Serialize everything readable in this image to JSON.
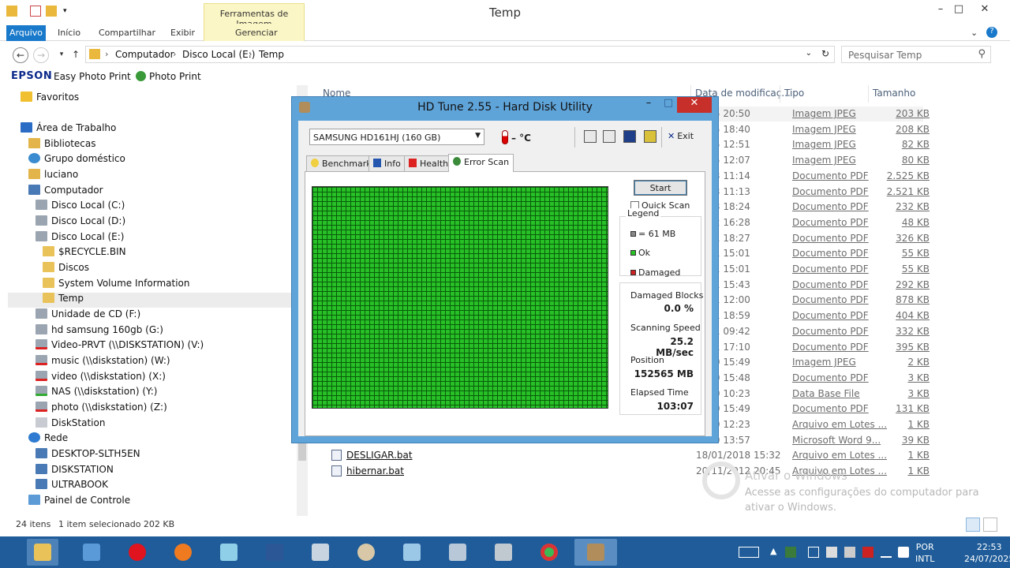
{
  "window": {
    "title": "Temp",
    "context_tab_top": "Ferramentas de Imagem",
    "context_tab_bottom": "Gerenciar"
  },
  "ribbon": {
    "tabs": [
      "Arquivo",
      "Início",
      "Compartilhar",
      "Exibir"
    ]
  },
  "address": {
    "crumbs": [
      "Computador",
      "Disco Local (E:)",
      "Temp"
    ],
    "search_placeholder": "Pesquisar Temp"
  },
  "epson": {
    "logo": "EPSON",
    "item1": "Easy Photo Print",
    "item2": "Photo Print"
  },
  "nav": {
    "favorites": "Favoritos",
    "items": [
      "Área de Trabalho",
      "Bibliotecas",
      "Grupo doméstico",
      "luciano",
      "Computador",
      "Disco Local (C:)",
      "Disco Local (D:)",
      "Disco Local (E:)",
      "$RECYCLE.BIN",
      "Discos",
      "System Volume Information",
      "Temp",
      "Unidade de CD (F:)",
      "hd samsung 160gb (G:)",
      "Video-PRVT (\\\\DISKSTATION) (V:)",
      "music (\\\\diskstation) (W:)",
      "video (\\\\diskstation) (X:)",
      "NAS (\\\\diskstation) (Y:)",
      "photo (\\\\diskstation) (Z:)",
      "DiskStation",
      "Rede",
      "DESKTOP-SLTH5EN",
      "DISKSTATION",
      "ULTRABOOK",
      "Painel de Controle"
    ]
  },
  "filelist": {
    "columns": [
      "Nome",
      "Data de modificaç...",
      "Tipo",
      "Tamanho"
    ],
    "rows": [
      {
        "name": "",
        "date": "2025 20:50",
        "type": "Imagem JPEG",
        "size": "203 KB"
      },
      {
        "name": "",
        "date": "2025 18:40",
        "type": "Imagem JPEG",
        "size": "208 KB"
      },
      {
        "name": "",
        "date": "2025 12:51",
        "type": "Imagem JPEG",
        "size": "82 KB"
      },
      {
        "name": "",
        "date": "2025 12:07",
        "type": "Imagem JPEG",
        "size": "80 KB"
      },
      {
        "name": "",
        "date": "2023 11:14",
        "type": "Documento PDF",
        "size": "2.525 KB"
      },
      {
        "name": "",
        "date": "2023 11:13",
        "type": "Documento PDF",
        "size": "2.521 KB"
      },
      {
        "name": "",
        "date": "2023 18:24",
        "type": "Documento PDF",
        "size": "232 KB"
      },
      {
        "name": "",
        "date": "2022 16:28",
        "type": "Documento PDF",
        "size": "48 KB"
      },
      {
        "name": "",
        "date": "2021 18:27",
        "type": "Documento PDF",
        "size": "326 KB"
      },
      {
        "name": "",
        "date": "2021 15:01",
        "type": "Documento PDF",
        "size": "55 KB"
      },
      {
        "name": "",
        "date": "2021 15:01",
        "type": "Documento PDF",
        "size": "55 KB"
      },
      {
        "name": "",
        "date": "2021 15:43",
        "type": "Documento PDF",
        "size": "292 KB"
      },
      {
        "name": "",
        "date": "2021 12:00",
        "type": "Documento PDF",
        "size": "878 KB"
      },
      {
        "name": "",
        "date": "2021 18:59",
        "type": "Documento PDF",
        "size": "404 KB"
      },
      {
        "name": "",
        "date": "2021 09:42",
        "type": "Documento PDF",
        "size": "332 KB"
      },
      {
        "name": "",
        "date": "2021 17:10",
        "type": "Documento PDF",
        "size": "395 KB"
      },
      {
        "name": "",
        "date": "2020 15:49",
        "type": "Imagem JPEG",
        "size": "2 KB"
      },
      {
        "name": "",
        "date": "2020 15:48",
        "type": "Documento PDF",
        "size": "3 KB"
      },
      {
        "name": "",
        "date": "2020 10:23",
        "type": "Data Base File",
        "size": "3 KB"
      },
      {
        "name": "",
        "date": "2020 15:49",
        "type": "Documento PDF",
        "size": "131 KB"
      },
      {
        "name": "",
        "date": "2020 12:23",
        "type": "Arquivo em Lotes ...",
        "size": "1 KB"
      },
      {
        "name": "",
        "date": "2020 13:57",
        "type": "Microsoft Word 9...",
        "size": "39 KB"
      },
      {
        "name": "DESLIGAR.bat",
        "date": "18/01/2018 15:32",
        "type": "Arquivo em Lotes ...",
        "size": "1 KB"
      },
      {
        "name": "hibernar.bat",
        "date": "20/11/2012 20:45",
        "type": "Arquivo em Lotes ...",
        "size": "1 KB"
      }
    ]
  },
  "watermark": {
    "line1": "Ativar o Windows",
    "line2": "Acesse as configurações do computador para ativar o Windows."
  },
  "status": {
    "count": "24 itens",
    "selected": "1 item selecionado  202 KB"
  },
  "hdtune": {
    "title": "HD Tune 2.55 - Hard Disk Utility",
    "drive": "SAMSUNG HD161HJ (160 GB)",
    "temp": "– °C",
    "exit": "Exit",
    "tabs": [
      "Benchmark",
      "Info",
      "Health",
      "Error Scan"
    ],
    "start": "Start",
    "quick_scan": "Quick Scan",
    "legend_title": "Legend",
    "legend": [
      "= 61 MB",
      "Ok",
      "Damaged"
    ],
    "damaged_blocks_label": "Damaged Blocks",
    "damaged_blocks_value": "0.0 %",
    "speed_label": "Scanning Speed",
    "speed_value": "25.2 MB/sec",
    "position_label": "Position",
    "position_value": "152565 MB",
    "elapsed_label": "Elapsed Time",
    "elapsed_value": "103:07"
  },
  "taskbar": {
    "lang1": "POR",
    "lang2": "INTL",
    "time": "22:53",
    "date": "24/07/2025"
  },
  "colors": {
    "accent": "#1979ca",
    "taskbar": "#1f5c99",
    "scan_ok": "#27c127",
    "hdtune_frame": "#5fa4d9"
  }
}
